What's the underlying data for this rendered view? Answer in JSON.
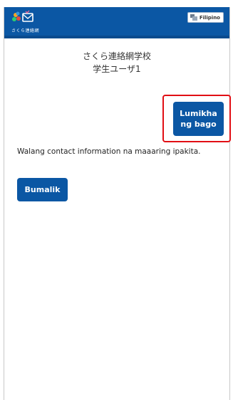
{
  "header": {
    "logo_text": "さくら連絡網",
    "language_label": "Filipino"
  },
  "main": {
    "school_name": "さくら連絡網学校",
    "user_name": "学生ユーザ1",
    "create_button_label": "Lumikha ng bago",
    "empty_message": "Walang contact information na maaaring ipakita.",
    "back_button_label": "Bumalik"
  },
  "colors": {
    "primary": "#0b57a4",
    "highlight": "#e10e14"
  },
  "icons": {
    "logo": "sakura-mail-logo-icon",
    "language": "language-flag-icon"
  }
}
